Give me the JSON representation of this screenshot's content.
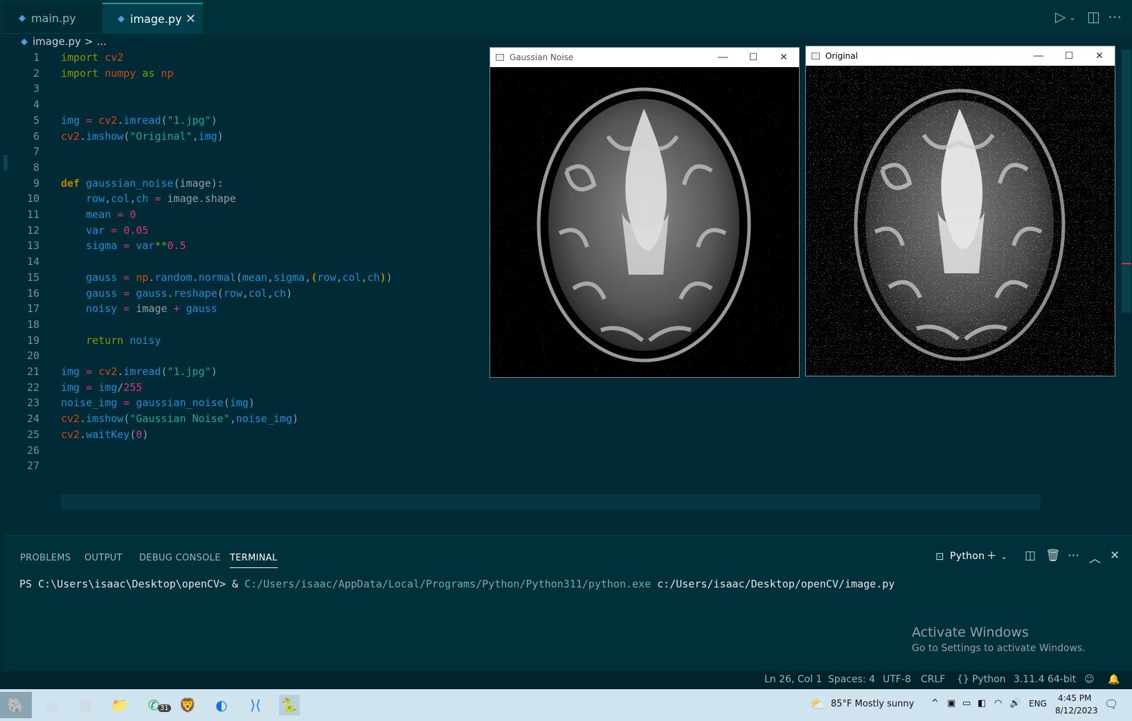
{
  "tabs": [
    {
      "label": "main.py"
    },
    {
      "label": "image.py"
    }
  ],
  "breadcrumb": {
    "file": "image.py",
    "sep": ">",
    "rest": "..."
  },
  "editor": {
    "line_numbers": [
      "1",
      "2",
      "3",
      "4",
      "5",
      "6",
      "7",
      "8",
      "9",
      "10",
      "11",
      "12",
      "13",
      "14",
      "15",
      "16",
      "17",
      "18",
      "19",
      "20",
      "21",
      "22",
      "23",
      "24",
      "25",
      "26",
      "27"
    ]
  },
  "windows": {
    "noise_title": "Gaussian Noise",
    "original_title": "Original"
  },
  "panel": {
    "tabs": [
      "PROBLEMS",
      "OUTPUT",
      "DEBUG CONSOLE",
      "TERMINAL"
    ],
    "terminal_profile": "Python",
    "prompt": "PS C:\\Users\\isaac\\Desktop\\openCV> & ",
    "exe": "C:/Users/isaac/AppData/Local/Programs/Python/Python311/python.exe",
    "script": " c:/Users/isaac/Desktop/openCV/image.py"
  },
  "activate": {
    "title": "Activate Windows",
    "subtitle": "Go to Settings to activate Windows."
  },
  "status": {
    "position": "Ln 26, Col 1",
    "spaces": "Spaces: 4",
    "encoding": "UTF-8",
    "eol": "CRLF",
    "language": "Python",
    "interpreter": "3.11.4 64-bit"
  },
  "taskbar": {
    "whatsapp_badge": "31",
    "weather": "85°F  Mostly sunny",
    "lang": "ENG",
    "time": "4:45 PM",
    "date": "8/12/2023"
  },
  "colors": {
    "editor_bg": "#002b36",
    "keyword": "#859900",
    "string": "#2aa198",
    "function": "#268bd2",
    "number": "#d33682"
  }
}
